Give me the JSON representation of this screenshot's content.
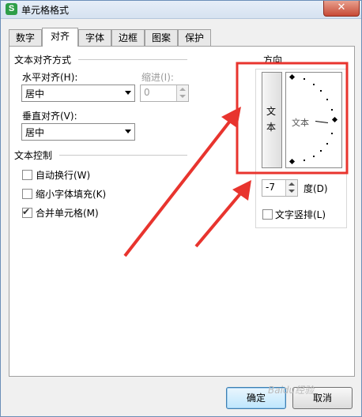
{
  "window": {
    "title": "单元格格式",
    "app_icon_letter": "S",
    "close_glyph": "✕"
  },
  "tabs": [
    {
      "label": "数字",
      "active": false
    },
    {
      "label": "对齐",
      "active": true
    },
    {
      "label": "字体",
      "active": false
    },
    {
      "label": "边框",
      "active": false
    },
    {
      "label": "图案",
      "active": false
    },
    {
      "label": "保护",
      "active": false
    }
  ],
  "alignment": {
    "group_label": "文本对齐方式",
    "horizontal_label": "水平对齐(H):",
    "horizontal_value": "居中",
    "indent_label": "缩进(I):",
    "indent_value": "0",
    "vertical_label": "垂直对齐(V):",
    "vertical_value": "居中"
  },
  "text_control": {
    "group_label": "文本控制",
    "wrap_text": {
      "label": "自动换行(W)",
      "checked": false
    },
    "shrink_to_fit": {
      "label": "缩小字体填充(K)",
      "checked": false
    },
    "merge_cells": {
      "label": "合并单元格(M)",
      "checked": true
    },
    "check_glyph": "✔"
  },
  "orientation": {
    "group_label": "方向",
    "vertical_text_chars": [
      "文",
      "本"
    ],
    "dial_text": "文本",
    "degrees_value": "-7",
    "degrees_label": "度(D)",
    "vertical_stack": {
      "label": "文字竖排(L)",
      "checked": false
    }
  },
  "buttons": {
    "ok": "确定",
    "cancel": "取消"
  },
  "watermark": "Baidu经验",
  "colors": {
    "annotation_red": "#e8342e",
    "window_border": "#6b8fb8"
  },
  "annotation": {
    "rotation_deg": -7
  }
}
